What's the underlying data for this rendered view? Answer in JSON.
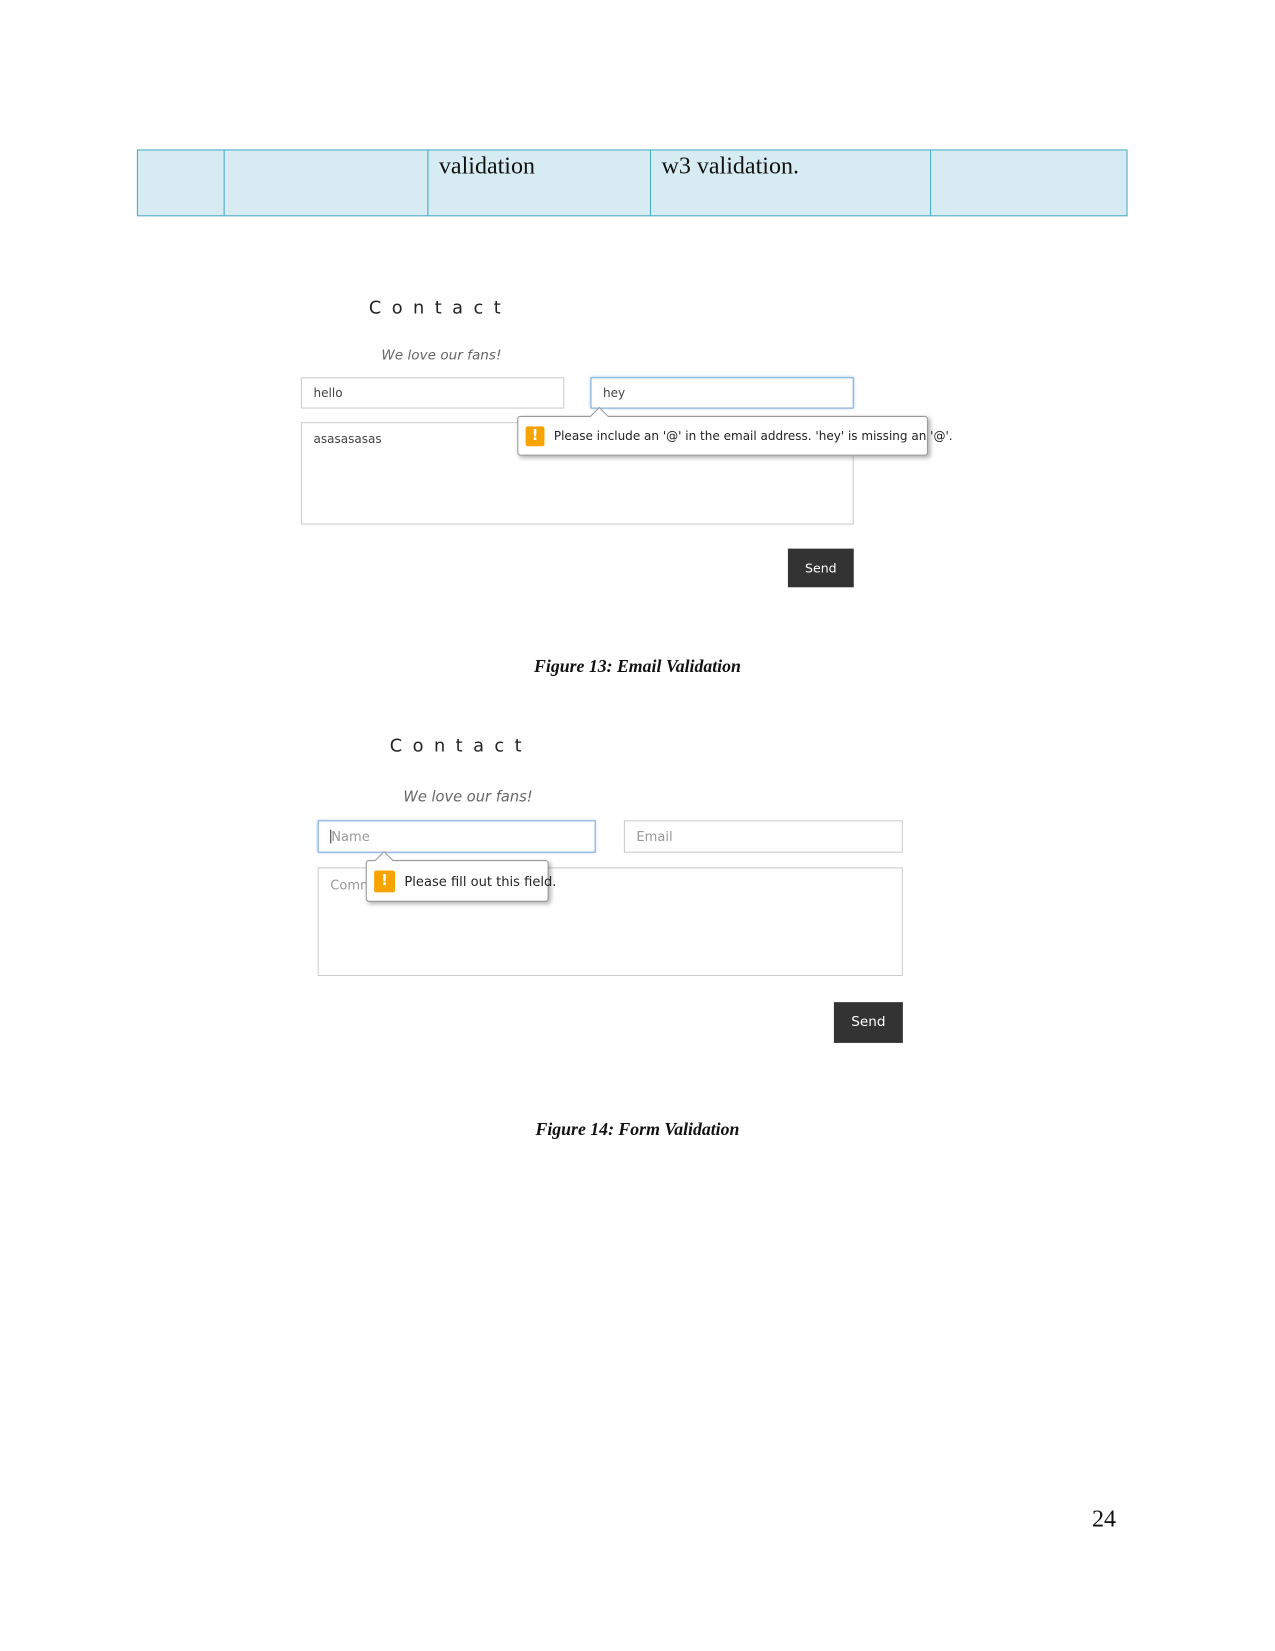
{
  "table_row": {
    "cells": [
      "",
      "",
      "validation",
      "w3 validation.",
      ""
    ]
  },
  "figure13": {
    "heading": "Contact",
    "tagline": "We love our fans!",
    "name_value": "hello",
    "email_value": "hey",
    "comment_value": "asasasasas",
    "tooltip": "Please include an '@' in the email address. 'hey' is missing an '@'.",
    "send_label": "Send",
    "caption": "Figure 13: Email Validation"
  },
  "figure14": {
    "heading": "Contact",
    "tagline": "We love our fans!",
    "name_placeholder": "Name",
    "email_placeholder": "Email",
    "comment_placeholder": "Comm",
    "tooltip": "Please fill out this field.",
    "send_label": "Send",
    "caption": "Figure 14: Form Validation"
  },
  "page_number": "24",
  "colors": {
    "table_fill": "#d6ebf2",
    "table_border": "#4bacc6",
    "warning": "#f7a400",
    "button": "#333333"
  }
}
